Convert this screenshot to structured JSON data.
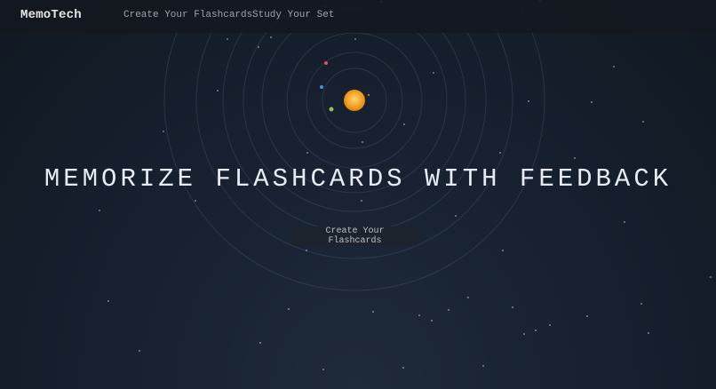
{
  "nav": {
    "brand": "MemoTech",
    "create_link": "Create Your Flashcards",
    "study_link": "Study Your Set"
  },
  "hero": {
    "title": "MEMORIZE FLASHCARDS WITH FEEDBACK",
    "cta_label": "Create Your Flashcards"
  },
  "colors": {
    "sun": "#f5a623",
    "planet_red": "#d9534f",
    "planet_blue": "#4a90d9",
    "planet_green": "#8fbf5a",
    "orbit": "#3a4a5c"
  }
}
